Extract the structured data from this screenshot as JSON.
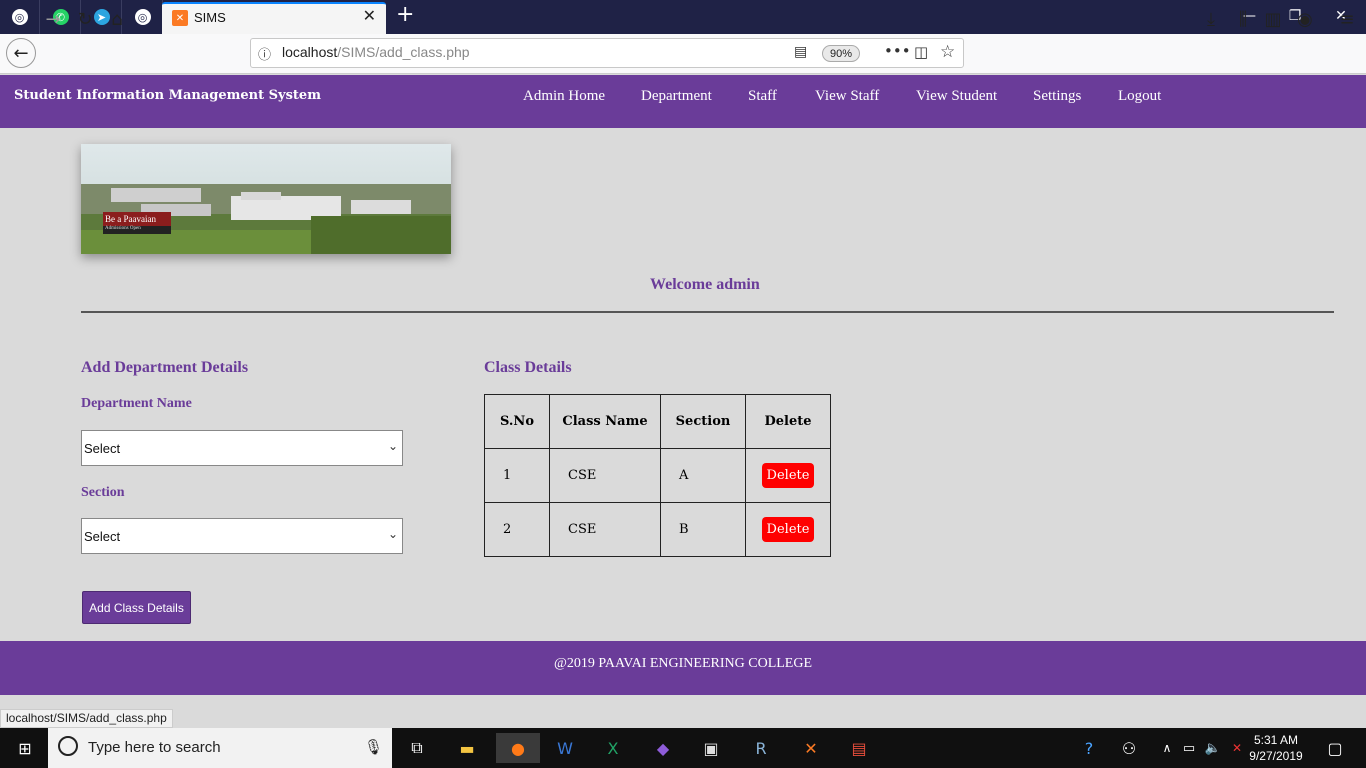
{
  "browser": {
    "active_tab_title": "SIMS",
    "url_host": "localhost",
    "url_path": "/SIMS/add_class.php",
    "zoom": "90%",
    "status_url": "localhost/SIMS/add_class.php"
  },
  "app": {
    "brand": "Student Information Management System",
    "menu": [
      "Admin Home",
      "Department",
      "Staff",
      "View Staff",
      "View Student",
      "Settings",
      "Logout"
    ],
    "banner_text": "Be a Paavaian",
    "banner_subtext": "Admissions Open",
    "welcome": "Welcome admin"
  },
  "form": {
    "heading": "Add Department Details",
    "department_label": "Department Name",
    "department_value": "Select",
    "section_label": "Section",
    "section_value": "Select",
    "submit_label": "Add Class Details"
  },
  "classes": {
    "heading": "Class Details",
    "columns": [
      "S.No",
      "Class Name",
      "Section",
      "Delete"
    ],
    "rows": [
      {
        "sno": "1",
        "class_name": "CSE",
        "section": "A",
        "action": "Delete"
      },
      {
        "sno": "2",
        "class_name": "CSE",
        "section": "B",
        "action": "Delete"
      }
    ]
  },
  "footer": {
    "text": "@2019 PAAVAI ENGINEERING COLLEGE"
  },
  "taskbar": {
    "search_placeholder": "Type here to search",
    "time": "5:31 AM",
    "date": "9/27/2019"
  },
  "colors": {
    "accent": "#6a3c99",
    "delete": "#ff0000",
    "background": "#dadada"
  }
}
